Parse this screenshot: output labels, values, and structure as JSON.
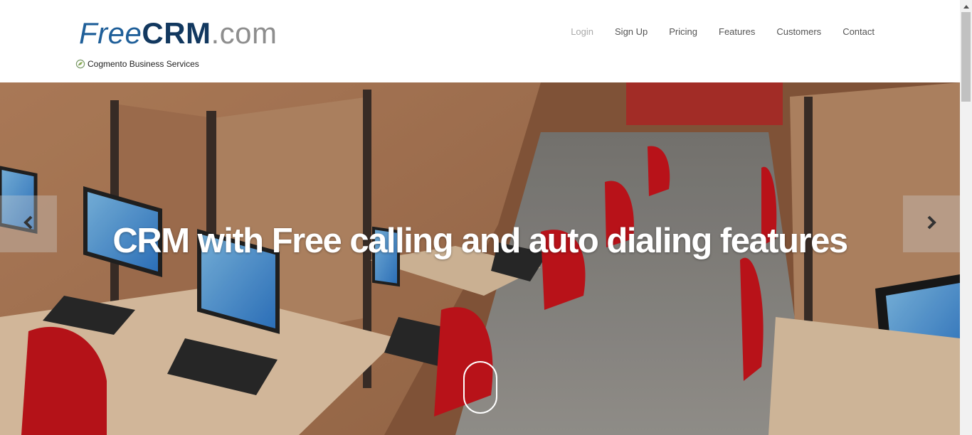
{
  "brand": {
    "free": "Free",
    "crm": "CRM",
    "com": ".com"
  },
  "tagline": {
    "text": "Cogmento Business Services",
    "icon": "cogmento-leaf-icon"
  },
  "nav": {
    "login": "Login",
    "signup": "Sign Up",
    "pricing": "Pricing",
    "features": "Features",
    "customers": "Customers",
    "contact": "Contact"
  },
  "hero": {
    "title": "CRM with Free calling and auto dialing features",
    "prev_icon": "chevron-left-icon",
    "next_icon": "chevron-right-icon",
    "scroll_icon": "mouse-scroll-icon"
  },
  "colors": {
    "brand_blue": "#1f5f99",
    "brand_navy": "#12385f",
    "brand_gray": "#8e8e8e",
    "nav_text": "#555555",
    "nav_muted": "#a9a9a9"
  }
}
